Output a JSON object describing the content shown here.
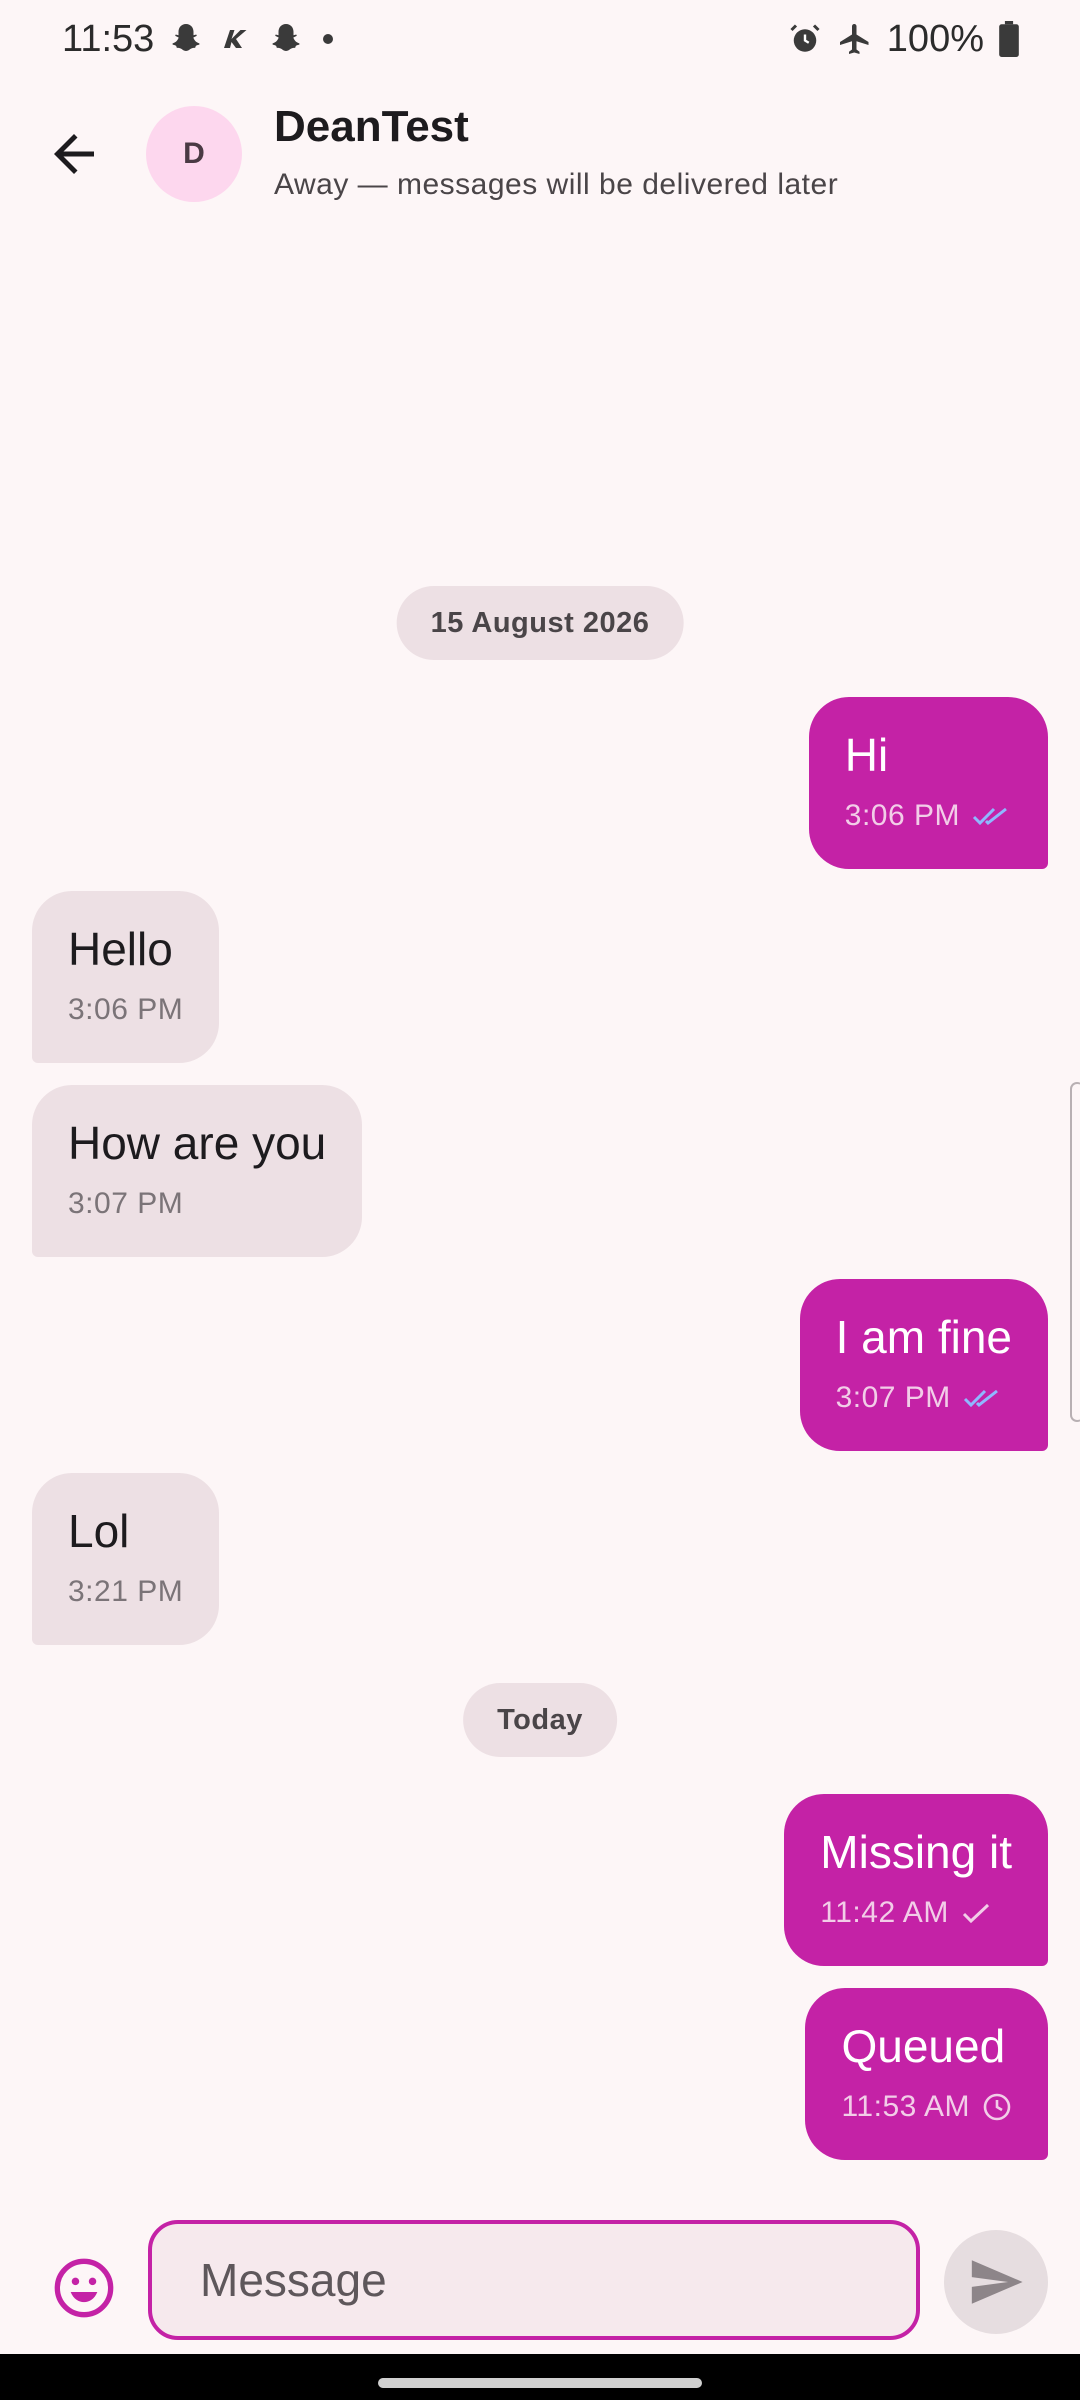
{
  "status_bar": {
    "time": "11:53",
    "notification_icons": [
      "snapchat-icon",
      "kbs-icon",
      "snapchat-icon",
      "dot-icon"
    ],
    "battery": "100%",
    "right_icons": [
      "alarm-icon",
      "airplane-icon",
      "battery-icon"
    ]
  },
  "header": {
    "avatar_letter": "D",
    "contact_name": "DeanTest",
    "status": "Away — messages will be delivered later"
  },
  "dividers": {
    "first": "15 August 2026",
    "second": "Today"
  },
  "messages": [
    {
      "direction": "out",
      "text": "Hi",
      "time": "3:06 PM",
      "status": "read"
    },
    {
      "direction": "in",
      "text": "Hello",
      "time": "3:06 PM"
    },
    {
      "direction": "in",
      "text": "How are you",
      "time": "3:07 PM"
    },
    {
      "direction": "out",
      "text": "I am fine",
      "time": "3:07 PM",
      "status": "read"
    },
    {
      "direction": "in",
      "text": "Lol",
      "time": "3:21 PM"
    },
    {
      "direction": "out",
      "text": "Missing it",
      "time": "11:42 AM",
      "status": "sent"
    },
    {
      "direction": "out",
      "text": "Queued",
      "time": "11:53 AM",
      "status": "queued"
    }
  ],
  "composer": {
    "placeholder": "Message",
    "value": ""
  },
  "colors": {
    "accent": "#c422a6",
    "incoming_bubble": "#ede0e4",
    "background": "#fdf6f7",
    "read_receipt": "#8fb8ff"
  }
}
